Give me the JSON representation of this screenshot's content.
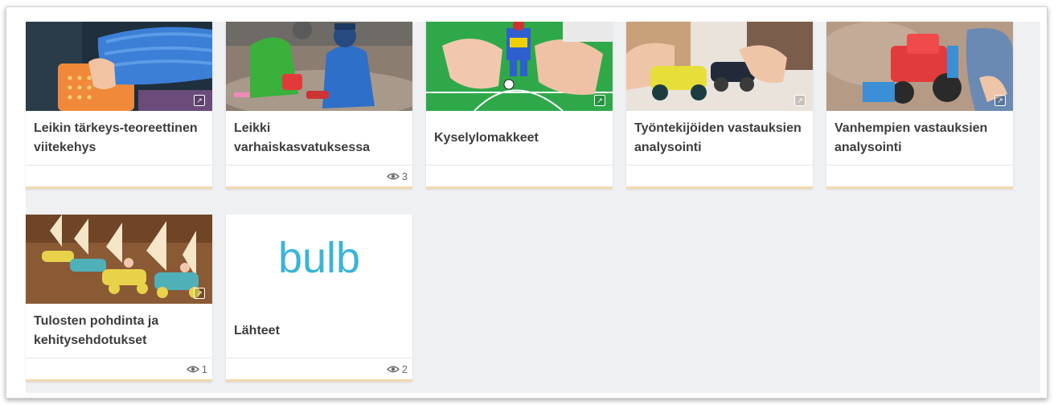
{
  "cards": [
    {
      "title": "Leikin tärkeys-teoreettinen viitekehys",
      "views": ""
    },
    {
      "title": "Leikki varhaiskasvatuksessa",
      "views": "3"
    },
    {
      "title": "Kyselylomakkeet",
      "views": ""
    },
    {
      "title": "Työntekijöiden vastauksien analysointi",
      "views": ""
    },
    {
      "title": "Vanhempien vastauksien analysointi",
      "views": ""
    },
    {
      "title": "Tulosten pohdinta ja kehitysehdotukset",
      "views": "1"
    },
    {
      "title": "Lähteet",
      "views": "2"
    }
  ],
  "logo": {
    "text": "bulb",
    "color": "#3ab4d9"
  },
  "colors": {
    "accent_border": "#f3d9ad",
    "board_bg": "#eef0f2",
    "title_text": "#3d3d3d"
  },
  "icons": {
    "external": "external-link-icon",
    "views": "eye-icon"
  }
}
